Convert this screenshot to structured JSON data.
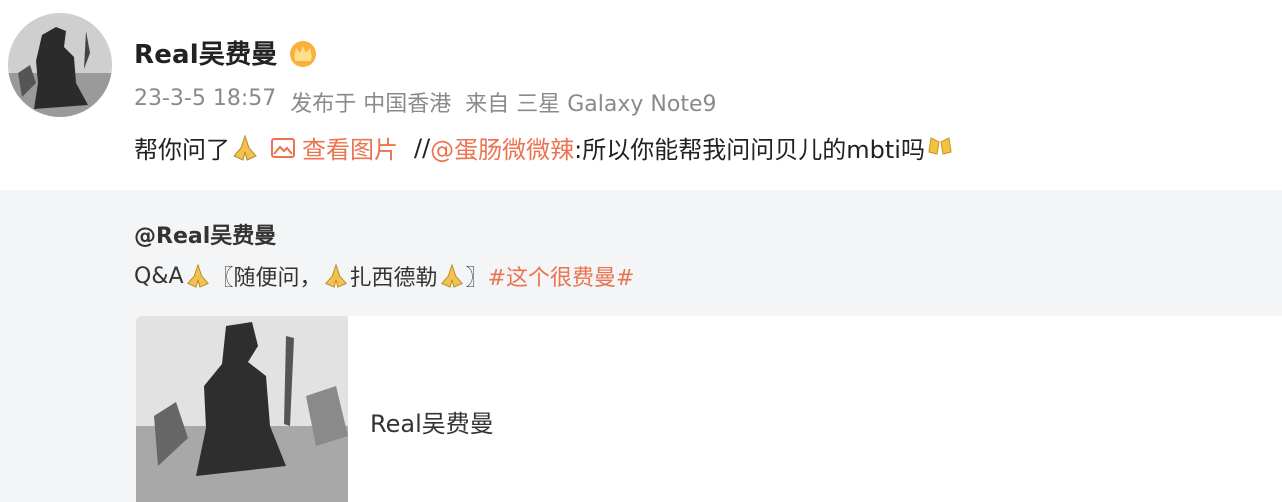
{
  "post": {
    "author": "Real吴费曼",
    "time": "23-3-5 18:57",
    "published_at": "发布于 中国香港",
    "source": "来自 三星 Galaxy Note9",
    "content": {
      "text": "帮你问了",
      "view_image": "查看图片",
      "repost_prefix": "//",
      "mention": "@蛋肠微微辣",
      "quote": ":所以你能帮我问问贝儿的mbti吗"
    }
  },
  "repost": {
    "author": "@Real吴费曼",
    "text_start": "Q&A",
    "bracket_open": "〖随便问，",
    "middle": "扎西德勒",
    "bracket_close": "〗",
    "topic": "#这个很费曼#",
    "card": {
      "title": "Real吴费曼"
    }
  },
  "icons": {
    "crown": "crown-badge-icon",
    "pray": "praying-hands-icon",
    "image": "image-icon",
    "sparkle": "cheers-emoji-icon"
  },
  "colors": {
    "accent": "#eb7350",
    "meta": "#8a8a8a",
    "repost_bg": "#f4f5f7"
  }
}
